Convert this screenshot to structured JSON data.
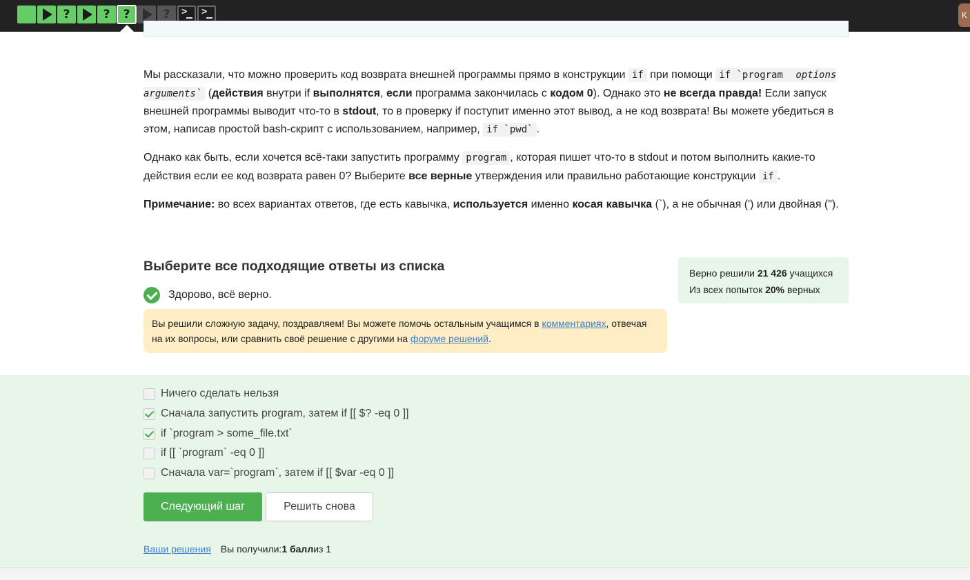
{
  "steps": {
    "items": [
      {
        "kind": "blank",
        "status": "solved"
      },
      {
        "kind": "play",
        "status": "solved"
      },
      {
        "kind": "question",
        "status": "solved",
        "glyph": "?"
      },
      {
        "kind": "play",
        "status": "solved"
      },
      {
        "kind": "question",
        "status": "solved",
        "glyph": "?"
      },
      {
        "kind": "question",
        "status": "current",
        "glyph": "?"
      },
      {
        "kind": "play",
        "status": "unsolved"
      },
      {
        "kind": "question",
        "status": "unsolved",
        "glyph": "?"
      },
      {
        "kind": "terminal",
        "status": "unsolved"
      },
      {
        "kind": "terminal",
        "status": "unsolved"
      }
    ],
    "colors": {
      "solved": "#66cc66",
      "unsolved": "#555555"
    }
  },
  "user_avatar_letter": "K",
  "lesson": {
    "p1": {
      "t1": "Мы рассказали, что можно проверить код возврата внешней программы прямо в конструкции ",
      "c1": "if",
      "t2": " при помощи ",
      "c2": "if `program ",
      "c3": "options arguments`",
      "t3": " (",
      "b1": "действия",
      "t4": " внутри if ",
      "b2": "выполнятся",
      "t5": ", ",
      "b3": "если",
      "t6": " программа закончилась с ",
      "b4": "кодом 0",
      "t7": "). Однако это ",
      "b5": "не всегда правда!",
      "t8": " Если запуск внешней программы выводит что-то в ",
      "b6": "stdout",
      "t9": ", то в проверку if поступит именно этот вывод, а не код возврата! Вы можете убедиться в этом, написав простой bash-скрипт с использованием, например, ",
      "c4": "if `pwd`",
      "t10": "."
    },
    "p2": {
      "t1": "Однако как быть, если хочется всё-таки запустить программу ",
      "c1": "program",
      "t2": ", которая пишет что-то в stdout и потом выполнить какие-то действия если ее код возврата равен 0? Выберите ",
      "b1": "все верные",
      "t3": " утверждения или правильно работающие конструкции ",
      "c2": "if",
      "t4": "."
    },
    "p3": {
      "b1": "Примечание:",
      "t1": " во всех вариантах ответов, где есть кавычка, ",
      "b2": "используется",
      "t2": " именно ",
      "b3": "косая кавычка",
      "t3": " (`), а не обычная (') или двойная (\")."
    }
  },
  "quiz": {
    "title": "Выберите все подходящие ответы из списка",
    "result": "Здорово, всё верно.",
    "stats": {
      "line1_prefix": "Верно решили ",
      "line1_value": "21 426",
      "line1_suffix": " учащихся",
      "line2_prefix": "Из всех попыток ",
      "line2_value": "20%",
      "line2_suffix": " верных"
    },
    "notice": {
      "t1": "Вы решили сложную задачу, поздравляем! Вы можете помочь остальным учащимся в ",
      "link1": "комментариях",
      "t2": ", отвечая на их вопросы, или сравнить своё решение с другими на ",
      "link2": "форуме решений",
      "t3": "."
    },
    "options": [
      {
        "label": "Ничего сделать нельзя",
        "checked": false
      },
      {
        "label": "Сначала запустить program, затем if [[ $? -eq 0 ]]",
        "checked": true
      },
      {
        "label": "if `program > some_file.txt`",
        "checked": true
      },
      {
        "label": "if [[ `program` -eq 0 ]]",
        "checked": false
      },
      {
        "label": "Сначала var=`program`, затем if [[ $var -eq 0 ]]",
        "checked": false
      }
    ],
    "next_button": "Следующий шаг",
    "retry_button": "Решить снова",
    "your_solutions_link": "Ваши решения",
    "score_prefix": "Вы получили: ",
    "score_value": "1 балл",
    "score_suffix": " из 1"
  }
}
